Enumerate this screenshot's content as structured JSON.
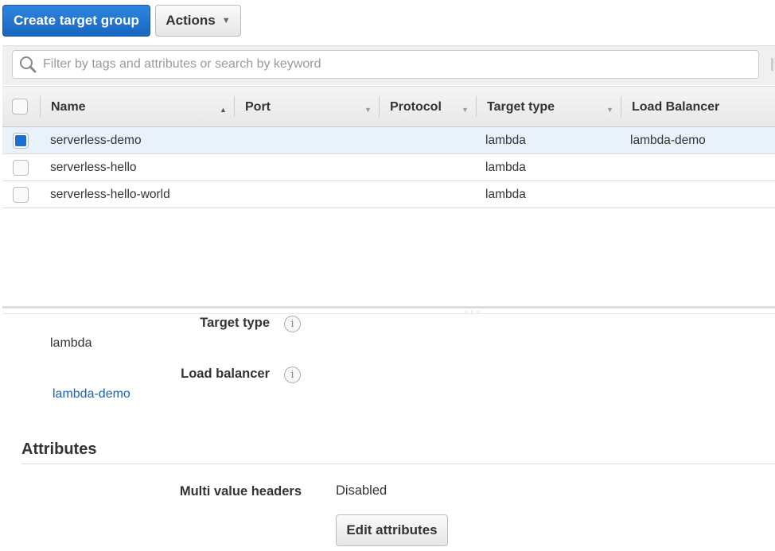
{
  "toolbar": {
    "create_label": "Create target group",
    "actions_label": "Actions"
  },
  "search": {
    "placeholder": "Filter by tags and attributes or search by keyword"
  },
  "table": {
    "columns": [
      "Name",
      "Port",
      "Protocol",
      "Target type",
      "Load Balancer"
    ],
    "rows": [
      {
        "name": "serverless-demo",
        "port": "",
        "protocol": "",
        "target_type": "lambda",
        "load_balancer": "lambda-demo",
        "selected": true
      },
      {
        "name": "serverless-hello",
        "port": "",
        "protocol": "",
        "target_type": "lambda",
        "load_balancer": "",
        "selected": false
      },
      {
        "name": "serverless-hello-world",
        "port": "",
        "protocol": "",
        "target_type": "lambda",
        "load_balancer": "",
        "selected": false
      }
    ]
  },
  "details": {
    "target_type_label": "Target type",
    "target_type_value": "lambda",
    "load_balancer_label": "Load balancer",
    "load_balancer_value": "lambda-demo"
  },
  "attributes": {
    "heading": "Attributes",
    "multi_value_label": "Multi value headers",
    "multi_value_value": "Disabled",
    "edit_label": "Edit attributes"
  },
  "colors": {
    "primary": "#1a6fd0",
    "link": "#1a63b8",
    "selected_row": "#e9f1fb"
  }
}
